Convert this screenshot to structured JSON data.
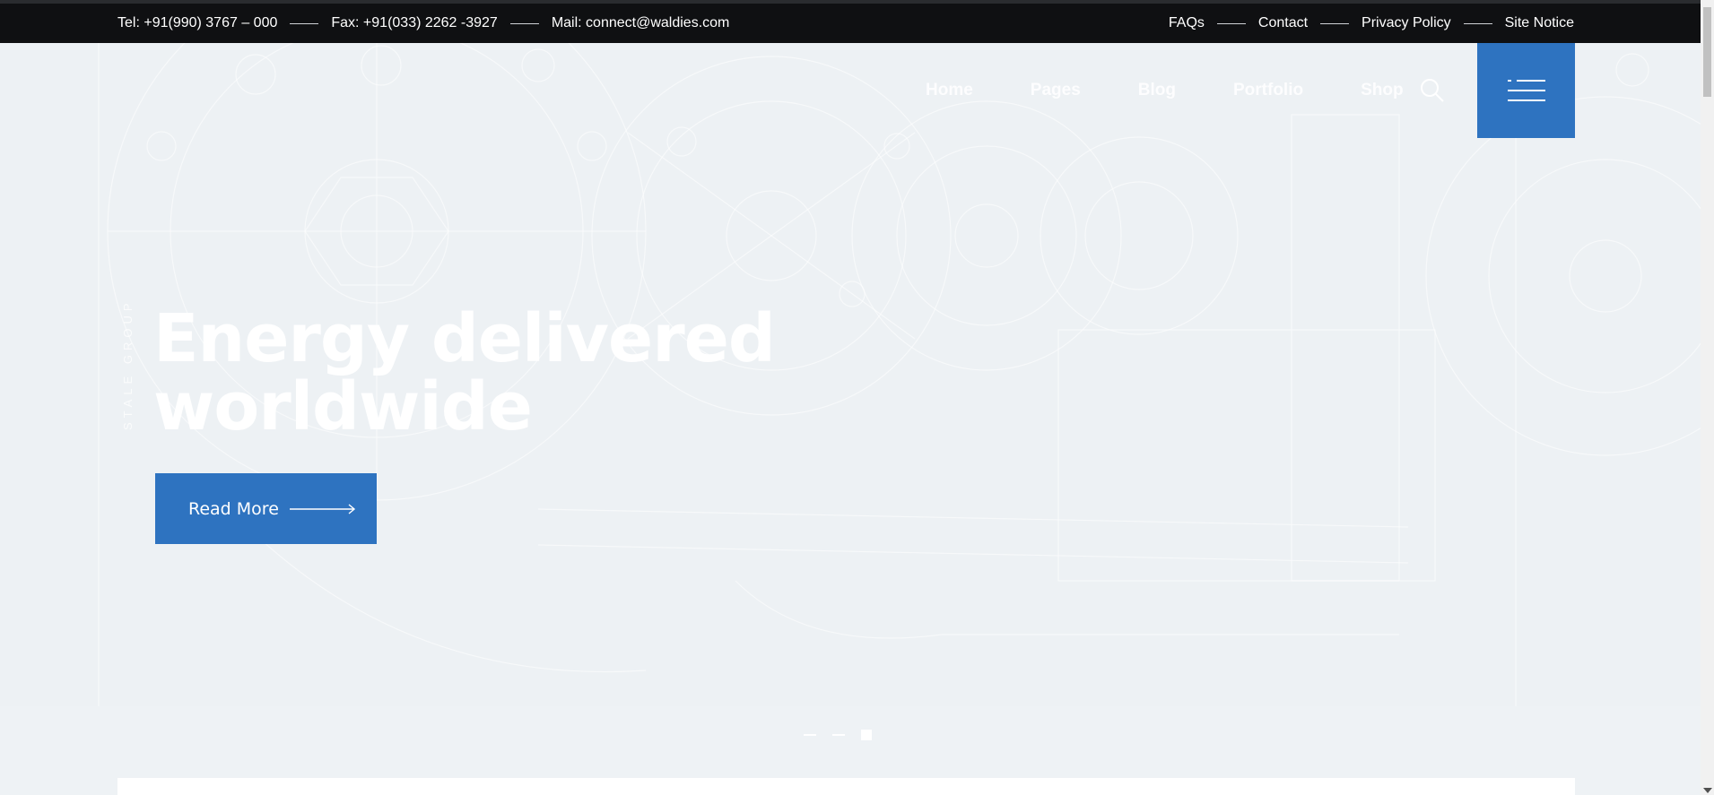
{
  "topbar": {
    "tel": "Tel: +91(990) 3767 – 000",
    "fax": "Fax: +91(033) 2262 -3927",
    "mail": "Mail: connect@waldies.com",
    "links": [
      "FAQs",
      "Contact",
      "Privacy Policy",
      "Site Notice"
    ]
  },
  "nav": {
    "items": [
      "Home",
      "Pages",
      "Blog",
      "Portfolio",
      "Shop"
    ],
    "search_icon": "search-icon",
    "menu_icon": "hamburger-menu-icon"
  },
  "hero": {
    "vertical_brand": "STALE GROUP",
    "headline_line1": "Energy delivered",
    "headline_line2": "worldwide",
    "cta_label": "Read More",
    "cta_icon": "arrow-right-icon"
  },
  "slider": {
    "slides": 3,
    "active_slide": 3
  },
  "colors": {
    "accent": "#2e73c0",
    "topbar_bg": "#0f1012",
    "hero_bg": "#edf1f4"
  }
}
